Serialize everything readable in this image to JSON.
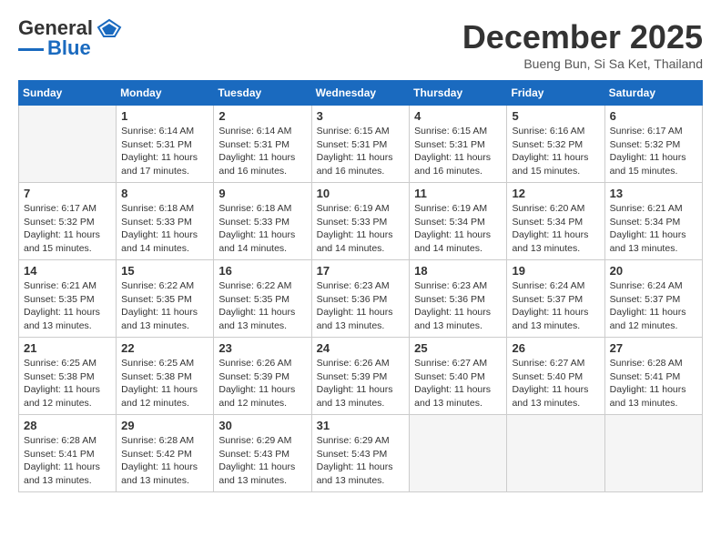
{
  "header": {
    "logo": {
      "line1": "General",
      "line2": "Blue"
    },
    "title": "December 2025",
    "location": "Bueng Bun, Si Sa Ket, Thailand"
  },
  "days_of_week": [
    "Sunday",
    "Monday",
    "Tuesday",
    "Wednesday",
    "Thursday",
    "Friday",
    "Saturday"
  ],
  "weeks": [
    [
      {
        "day": "",
        "info": ""
      },
      {
        "day": "1",
        "info": "Sunrise: 6:14 AM\nSunset: 5:31 PM\nDaylight: 11 hours\nand 17 minutes."
      },
      {
        "day": "2",
        "info": "Sunrise: 6:14 AM\nSunset: 5:31 PM\nDaylight: 11 hours\nand 16 minutes."
      },
      {
        "day": "3",
        "info": "Sunrise: 6:15 AM\nSunset: 5:31 PM\nDaylight: 11 hours\nand 16 minutes."
      },
      {
        "day": "4",
        "info": "Sunrise: 6:15 AM\nSunset: 5:31 PM\nDaylight: 11 hours\nand 16 minutes."
      },
      {
        "day": "5",
        "info": "Sunrise: 6:16 AM\nSunset: 5:32 PM\nDaylight: 11 hours\nand 15 minutes."
      },
      {
        "day": "6",
        "info": "Sunrise: 6:17 AM\nSunset: 5:32 PM\nDaylight: 11 hours\nand 15 minutes."
      }
    ],
    [
      {
        "day": "7",
        "info": "Sunrise: 6:17 AM\nSunset: 5:32 PM\nDaylight: 11 hours\nand 15 minutes."
      },
      {
        "day": "8",
        "info": "Sunrise: 6:18 AM\nSunset: 5:33 PM\nDaylight: 11 hours\nand 14 minutes."
      },
      {
        "day": "9",
        "info": "Sunrise: 6:18 AM\nSunset: 5:33 PM\nDaylight: 11 hours\nand 14 minutes."
      },
      {
        "day": "10",
        "info": "Sunrise: 6:19 AM\nSunset: 5:33 PM\nDaylight: 11 hours\nand 14 minutes."
      },
      {
        "day": "11",
        "info": "Sunrise: 6:19 AM\nSunset: 5:34 PM\nDaylight: 11 hours\nand 14 minutes."
      },
      {
        "day": "12",
        "info": "Sunrise: 6:20 AM\nSunset: 5:34 PM\nDaylight: 11 hours\nand 13 minutes."
      },
      {
        "day": "13",
        "info": "Sunrise: 6:21 AM\nSunset: 5:34 PM\nDaylight: 11 hours\nand 13 minutes."
      }
    ],
    [
      {
        "day": "14",
        "info": "Sunrise: 6:21 AM\nSunset: 5:35 PM\nDaylight: 11 hours\nand 13 minutes."
      },
      {
        "day": "15",
        "info": "Sunrise: 6:22 AM\nSunset: 5:35 PM\nDaylight: 11 hours\nand 13 minutes."
      },
      {
        "day": "16",
        "info": "Sunrise: 6:22 AM\nSunset: 5:35 PM\nDaylight: 11 hours\nand 13 minutes."
      },
      {
        "day": "17",
        "info": "Sunrise: 6:23 AM\nSunset: 5:36 PM\nDaylight: 11 hours\nand 13 minutes."
      },
      {
        "day": "18",
        "info": "Sunrise: 6:23 AM\nSunset: 5:36 PM\nDaylight: 11 hours\nand 13 minutes."
      },
      {
        "day": "19",
        "info": "Sunrise: 6:24 AM\nSunset: 5:37 PM\nDaylight: 11 hours\nand 13 minutes."
      },
      {
        "day": "20",
        "info": "Sunrise: 6:24 AM\nSunset: 5:37 PM\nDaylight: 11 hours\nand 12 minutes."
      }
    ],
    [
      {
        "day": "21",
        "info": "Sunrise: 6:25 AM\nSunset: 5:38 PM\nDaylight: 11 hours\nand 12 minutes."
      },
      {
        "day": "22",
        "info": "Sunrise: 6:25 AM\nSunset: 5:38 PM\nDaylight: 11 hours\nand 12 minutes."
      },
      {
        "day": "23",
        "info": "Sunrise: 6:26 AM\nSunset: 5:39 PM\nDaylight: 11 hours\nand 12 minutes."
      },
      {
        "day": "24",
        "info": "Sunrise: 6:26 AM\nSunset: 5:39 PM\nDaylight: 11 hours\nand 13 minutes."
      },
      {
        "day": "25",
        "info": "Sunrise: 6:27 AM\nSunset: 5:40 PM\nDaylight: 11 hours\nand 13 minutes."
      },
      {
        "day": "26",
        "info": "Sunrise: 6:27 AM\nSunset: 5:40 PM\nDaylight: 11 hours\nand 13 minutes."
      },
      {
        "day": "27",
        "info": "Sunrise: 6:28 AM\nSunset: 5:41 PM\nDaylight: 11 hours\nand 13 minutes."
      }
    ],
    [
      {
        "day": "28",
        "info": "Sunrise: 6:28 AM\nSunset: 5:41 PM\nDaylight: 11 hours\nand 13 minutes."
      },
      {
        "day": "29",
        "info": "Sunrise: 6:28 AM\nSunset: 5:42 PM\nDaylight: 11 hours\nand 13 minutes."
      },
      {
        "day": "30",
        "info": "Sunrise: 6:29 AM\nSunset: 5:43 PM\nDaylight: 11 hours\nand 13 minutes."
      },
      {
        "day": "31",
        "info": "Sunrise: 6:29 AM\nSunset: 5:43 PM\nDaylight: 11 hours\nand 13 minutes."
      },
      {
        "day": "",
        "info": ""
      },
      {
        "day": "",
        "info": ""
      },
      {
        "day": "",
        "info": ""
      }
    ]
  ]
}
